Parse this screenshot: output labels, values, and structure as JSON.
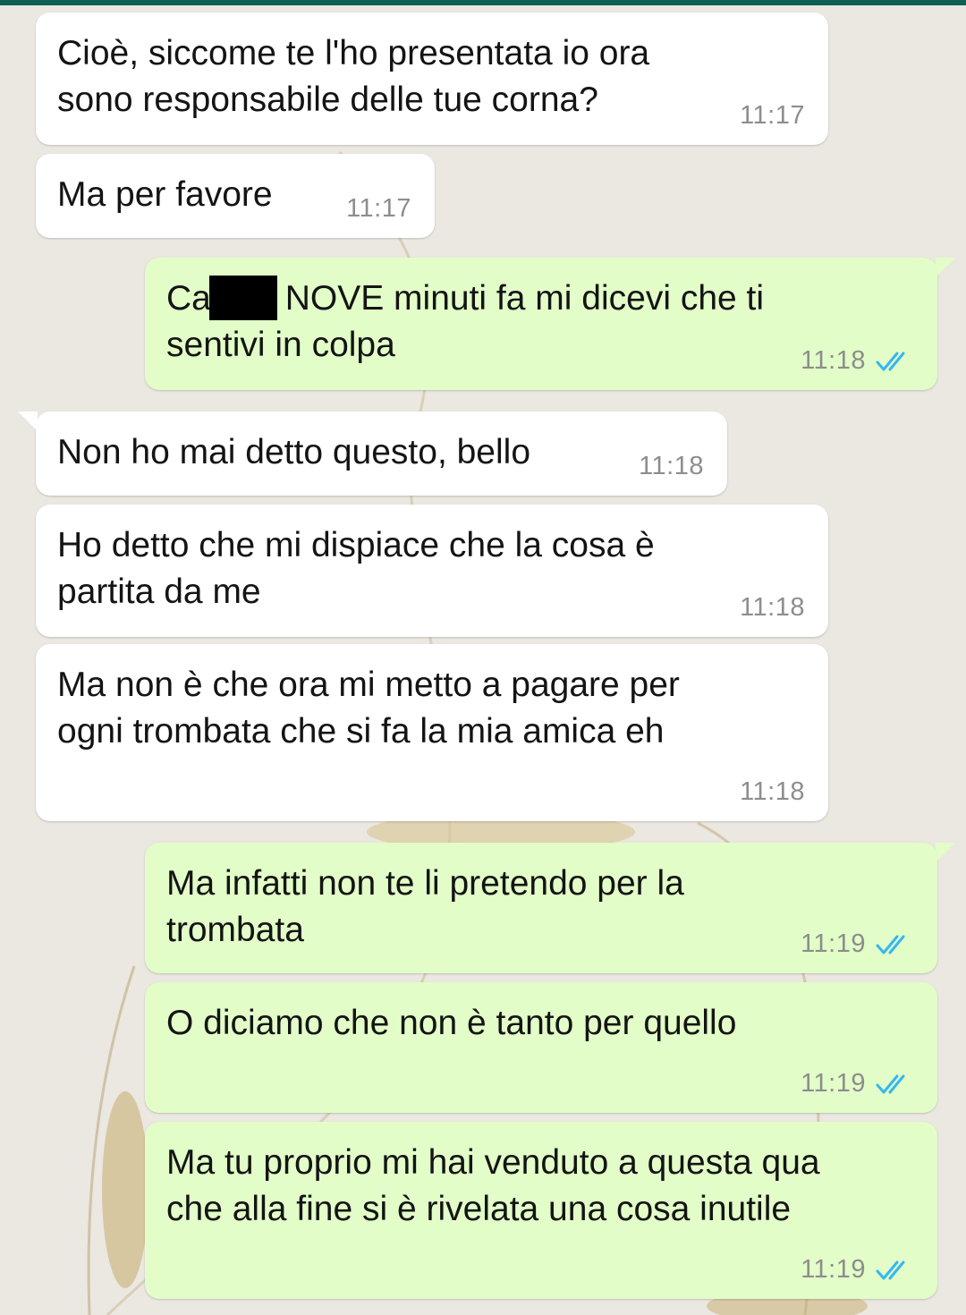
{
  "messages": [
    {
      "text": "Cioè, siccome te l'ho presentata io ora\nsono responsabile delle tue corna?",
      "time": "11:17"
    },
    {
      "text": "Ma per favore",
      "time": "11:17"
    },
    {
      "prefix": "Ca",
      "suffix": " NOVE minuti fa mi dicevi che ti\nsentivi in colpa",
      "time": "11:18",
      "status": "read"
    },
    {
      "text": "Non ho mai detto questo, bello",
      "time": "11:18"
    },
    {
      "text": "Ho detto che mi dispiace che la cosa è\npartita da me",
      "time": "11:18"
    },
    {
      "text": "Ma non è che ora mi metto a pagare per\nogni trombata che si fa la mia amica eh",
      "time": "11:18"
    },
    {
      "text": "Ma infatti non te li pretendo per la\ntrombata",
      "time": "11:19",
      "status": "read"
    },
    {
      "text": "O diciamo che non è tanto per quello",
      "time": "11:19",
      "status": "read"
    },
    {
      "text": "Ma tu proprio mi hai venduto a questa qua\nche alla fine si è rivelata una cosa inutile",
      "time": "11:19",
      "status": "read"
    }
  ],
  "colors": {
    "incoming_bubble": "#ffffff",
    "outgoing_bubble": "#e2fdc8",
    "read_ticks": "#34b7f1",
    "header": "#0f5f54"
  },
  "icons": {
    "read_receipt": "double-check-icon"
  }
}
